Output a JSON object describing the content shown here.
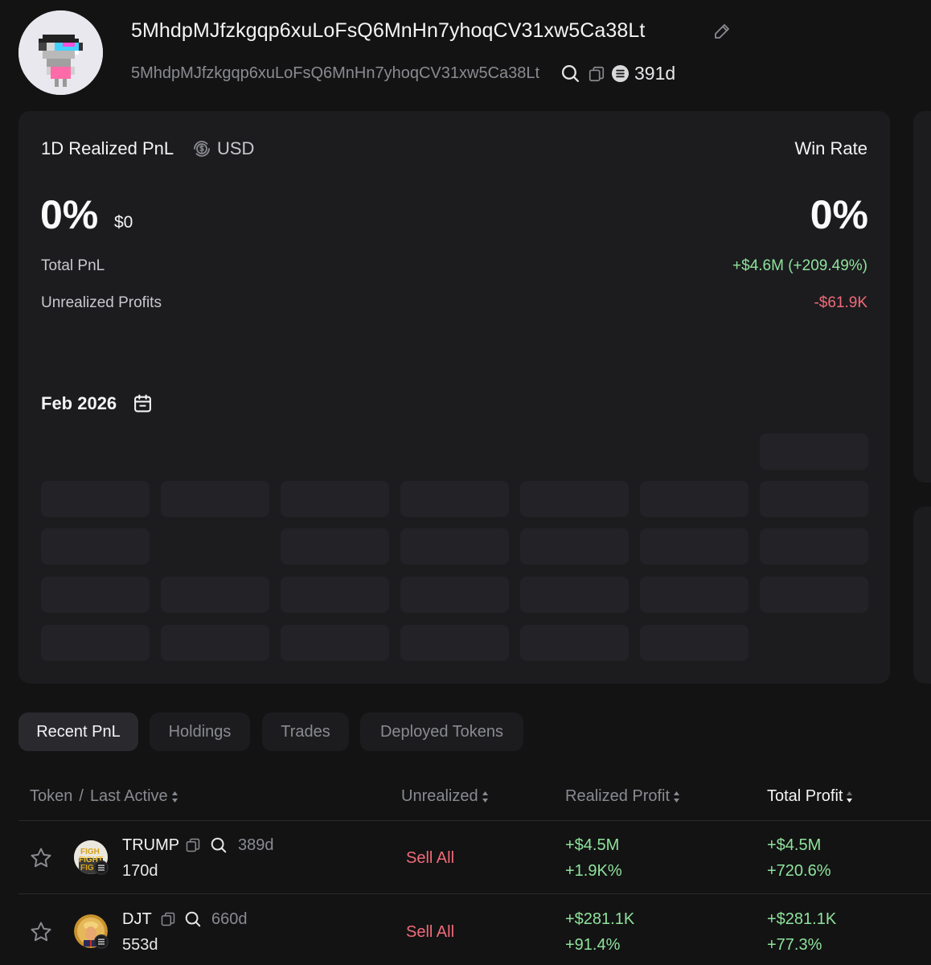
{
  "header": {
    "wallet_name": "5MhdpMJfzkgqp6xuLoFsQ6MnHn7yhoqCV31xw5Ca38Lt",
    "wallet_address": "5MhdpMJfzkgqp6xuLoFsQ6MnHn7yhoqCV31xw5Ca38Lt",
    "age": "391d"
  },
  "summary": {
    "pnl_title": "1D Realized PnL",
    "currency": "USD",
    "win_rate_title": "Win Rate",
    "realized_pct": "0%",
    "realized_usd": "$0",
    "win_rate": "0%",
    "total_pnl_label": "Total PnL",
    "total_pnl_value": "+$4.6M (+209.49%)",
    "unrealized_label": "Unrealized Profits",
    "unrealized_value": "-$61.9K"
  },
  "calendar": {
    "month": "Feb 2026"
  },
  "tabs": [
    {
      "label": "Recent PnL",
      "active": true
    },
    {
      "label": "Holdings",
      "active": false
    },
    {
      "label": "Trades",
      "active": false
    },
    {
      "label": "Deployed Tokens",
      "active": false
    }
  ],
  "table": {
    "headers": {
      "token": "Token",
      "separator": "/",
      "last_active": "Last Active",
      "unrealized": "Unrealized",
      "realized": "Realized Profit",
      "total": "Total Profit"
    },
    "rows": [
      {
        "token": "TRUMP",
        "age": "389d",
        "last_active": "170d",
        "unrealized": "Sell All",
        "realized_usd": "+$4.5M",
        "realized_pct": "+1.9K%",
        "total_usd": "+$4.5M",
        "total_pct": "+720.6%",
        "icon": "trump-token-icon"
      },
      {
        "token": "DJT",
        "age": "660d",
        "last_active": "553d",
        "unrealized": "Sell All",
        "realized_usd": "+$281.1K",
        "realized_pct": "+91.4%",
        "total_usd": "+$281.1K",
        "total_pct": "+77.3%",
        "icon": "djt-token-icon"
      }
    ]
  },
  "colors": {
    "background": "#131314",
    "card": "#1c1c1f",
    "positive": "#8fe39b",
    "negative": "#f06b78",
    "muted": "#8a8b91"
  }
}
